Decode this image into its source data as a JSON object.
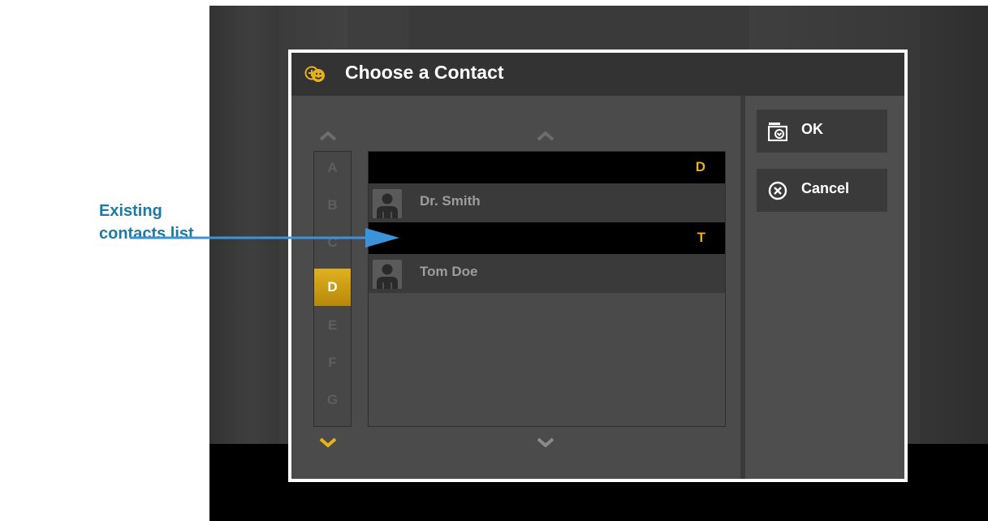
{
  "annotation": {
    "line1": "Existing",
    "line2": "contacts list"
  },
  "dialog": {
    "title": "Choose a Contact"
  },
  "alphabet": {
    "letters": [
      "A",
      "B",
      "C",
      "D",
      "E",
      "F",
      "G"
    ],
    "selected": "D"
  },
  "contacts": {
    "groups": [
      {
        "letter": "D",
        "name": "Dr. Smith"
      },
      {
        "letter": "T",
        "name": "Tom Doe"
      }
    ]
  },
  "buttons": {
    "ok": "OK",
    "cancel": "Cancel"
  },
  "colors": {
    "accent": "#e6b21c",
    "annotation": "#1b7aa6",
    "arrow": "#3d93d9"
  },
  "icons": {
    "title": "contacts-icon",
    "scroll_up": "chevron-up-icon",
    "scroll_down": "chevron-down-icon",
    "avatar": "person-silhouette-icon",
    "ok": "inbox-check-icon",
    "cancel": "circle-x-icon"
  }
}
